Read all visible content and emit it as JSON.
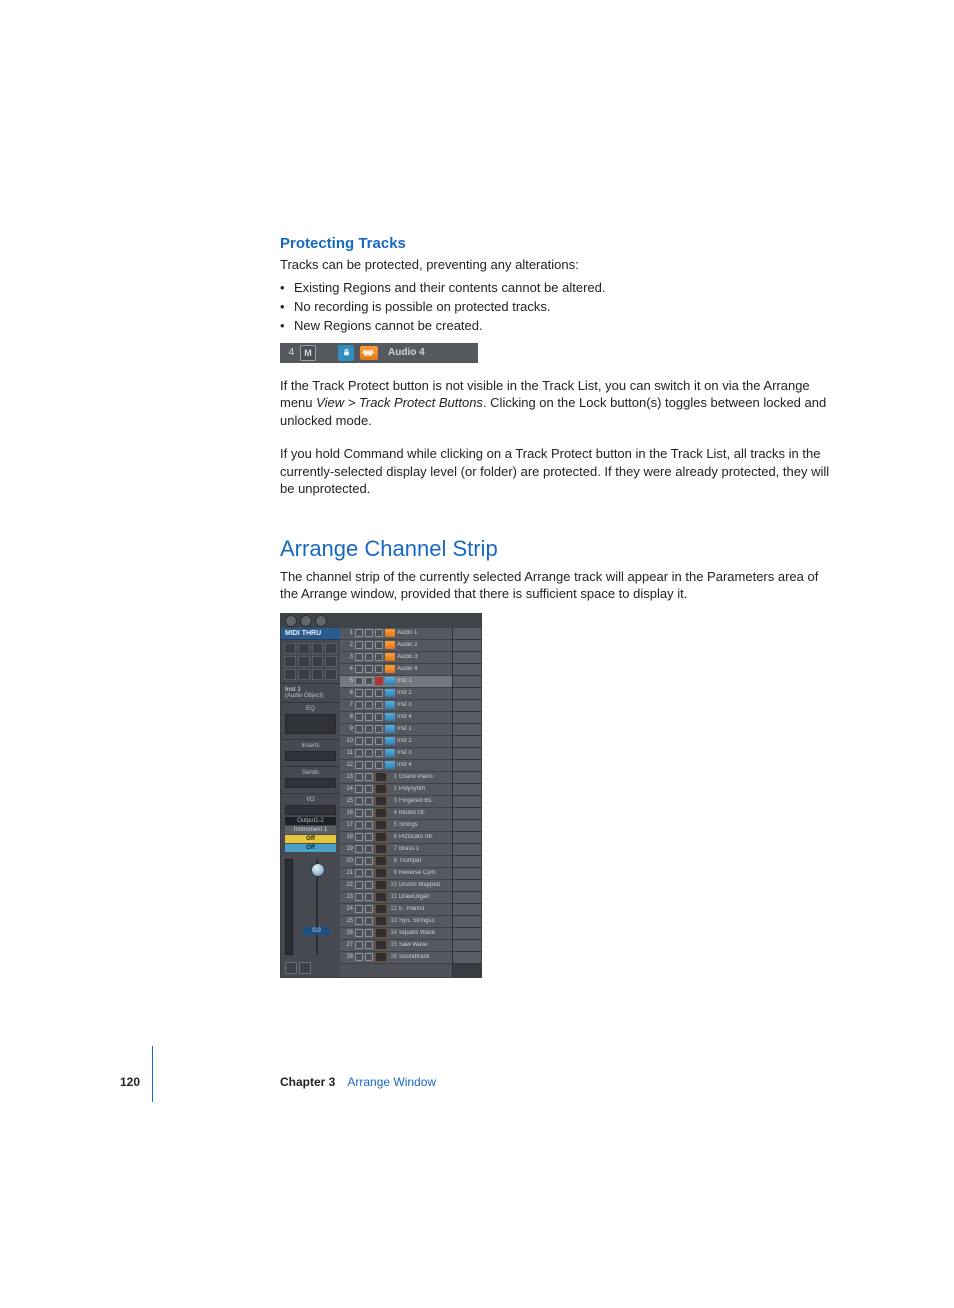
{
  "section1": {
    "heading": "Protecting Tracks",
    "intro": "Tracks can be protected, preventing any alterations:",
    "bullets": [
      "Existing Regions and their contents cannot be altered.",
      "No recording is possible on protected tracks.",
      "New Regions cannot be created."
    ],
    "trackHeader": {
      "number": "4",
      "mute": "M",
      "label": "Audio 4"
    },
    "para2a": "If the Track Protect button is not visible in the Track List, you can switch it on via the Arrange menu ",
    "para2menu": "View > Track Protect Buttons",
    "para2b": ". Clicking on the Lock button(s) toggles between locked and unlocked mode.",
    "para3": "If you hold Command while clicking on a Track Protect button in the Track List, all tracks in the currently-selected display level (or folder) are protected. If they were already protected, they will be unprotected."
  },
  "section2": {
    "heading": "Arrange Channel Strip",
    "intro": "The channel strip of the currently selected Arrange track will appear in the Parameters area of the Arrange window, provided that there is sufficient space to display it."
  },
  "arrangeGraphic": {
    "left": {
      "midithru": "MIDI THRU",
      "instHeader": "Inst 1",
      "instSub": "(Audio Object)",
      "eq": "EQ",
      "inserts": "Inserts",
      "sends": "Sends",
      "io": "I/O",
      "output": "Output1-2",
      "instrument": "Instrument 1",
      "off": "Off",
      "off2": "Off",
      "faderVal": "0.0"
    },
    "tracks": [
      {
        "n": "1",
        "type": "aud",
        "name": "Audio 1"
      },
      {
        "n": "2",
        "type": "aud",
        "name": "Audio 2"
      },
      {
        "n": "3",
        "type": "aud",
        "name": "Audio 3"
      },
      {
        "n": "4",
        "type": "aud",
        "name": "Audio 4"
      },
      {
        "n": "5",
        "type": "inst",
        "name": "Inst 1",
        "sel": true,
        "rec": true
      },
      {
        "n": "6",
        "type": "inst",
        "name": "Inst 2"
      },
      {
        "n": "7",
        "type": "inst",
        "name": "Inst 3"
      },
      {
        "n": "8",
        "type": "inst",
        "name": "Inst 4"
      },
      {
        "n": "9",
        "type": "inst",
        "name": "Inst 1"
      },
      {
        "n": "10",
        "type": "inst",
        "name": "Inst 2"
      },
      {
        "n": "11",
        "type": "inst",
        "name": "Inst 3"
      },
      {
        "n": "12",
        "type": "inst",
        "name": "Inst 4"
      },
      {
        "n": "13",
        "type": "midi",
        "sub": "1",
        "name": "Grand Piano"
      },
      {
        "n": "14",
        "type": "midi",
        "sub": "2",
        "name": "Polysynth"
      },
      {
        "n": "15",
        "type": "midi",
        "sub": "3",
        "name": "Fingered Bs."
      },
      {
        "n": "16",
        "type": "midi",
        "sub": "4",
        "name": "Muted Gt."
      },
      {
        "n": "17",
        "type": "midi",
        "sub": "5",
        "name": "Strings"
      },
      {
        "n": "18",
        "type": "midi",
        "sub": "6",
        "name": "Pizzicato Str"
      },
      {
        "n": "19",
        "type": "midi",
        "sub": "7",
        "name": "Brass 1"
      },
      {
        "n": "20",
        "type": "midi",
        "sub": "8",
        "name": "Trumpet"
      },
      {
        "n": "21",
        "type": "midi",
        "sub": "9",
        "name": "Reverse Cym."
      },
      {
        "n": "22",
        "type": "midi",
        "sub": "10",
        "name": "Drums Mapped"
      },
      {
        "n": "23",
        "type": "midi",
        "sub": "11",
        "name": "DrawOrgan"
      },
      {
        "n": "24",
        "type": "midi",
        "sub": "12",
        "name": "E. Piano1"
      },
      {
        "n": "25",
        "type": "midi",
        "sub": "13",
        "name": "Syn. Strings1"
      },
      {
        "n": "26",
        "type": "midi",
        "sub": "14",
        "name": "Square Wave"
      },
      {
        "n": "27",
        "type": "midi",
        "sub": "15",
        "name": "Saw Wave"
      },
      {
        "n": "28",
        "type": "midi",
        "sub": "16",
        "name": "Soundtrack"
      }
    ]
  },
  "footer": {
    "page": "120",
    "chapterLabel": "Chapter 3",
    "chapterTitle": "Arrange Window"
  }
}
